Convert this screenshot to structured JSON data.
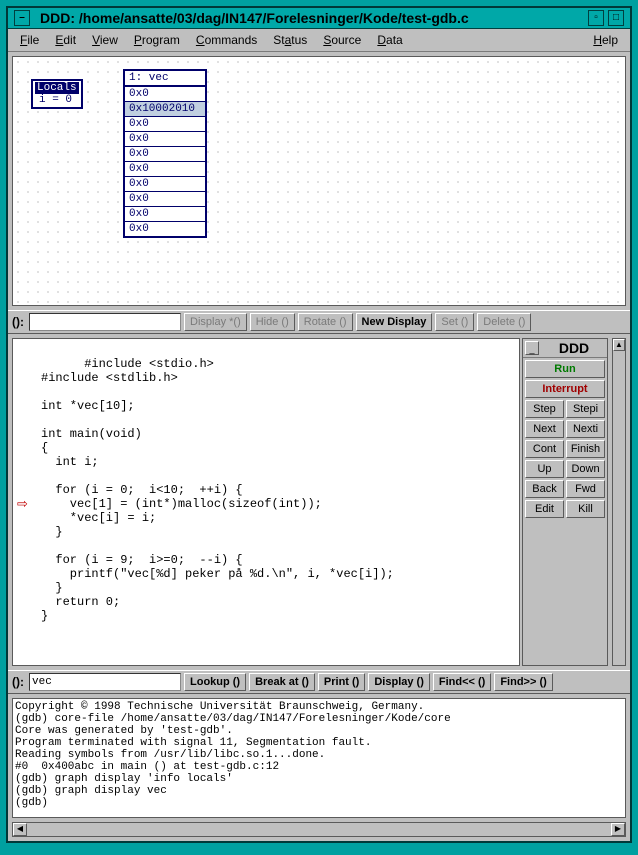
{
  "window": {
    "title": "DDD: /home/ansatte/03/dag/IN147/Forelesninger/Kode/test-gdb.c"
  },
  "menu": {
    "file": "File",
    "edit": "Edit",
    "view": "View",
    "program": "Program",
    "commands": "Commands",
    "status": "Status",
    "source": "Source",
    "data": "Data",
    "help": "Help"
  },
  "locals": {
    "title": "Locals",
    "row": "i = 0"
  },
  "vec": {
    "title": "1: vec",
    "rows": [
      "0x0",
      "0x10002010",
      "0x0",
      "0x0",
      "0x0",
      "0x0",
      "0x0",
      "0x0",
      "0x0",
      "0x0"
    ],
    "selected_index": 1
  },
  "argbar": {
    "label": "():",
    "value": "",
    "btns": {
      "display_star": "Display *()",
      "hide": "Hide ()",
      "rotate": "Rotate ()",
      "new_display": "New Display",
      "set": "Set ()",
      "delete": "Delete ()"
    }
  },
  "source_code": "#include <stdio.h>\n#include <stdlib.h>\n\nint *vec[10];\n\nint main(void)\n{\n  int i;\n\n  for (i = 0;  i<10;  ++i) {\n    vec[1] = (int*)malloc(sizeof(int));\n    *vec[i] = i;\n  }\n\n  for (i = 9;  i>=0;  --i) {\n    printf(\"vec[%d] peker på %d.\\n\", i, *vec[i]);\n  }\n  return 0;\n}",
  "stop_line_index": 11,
  "cmd_panel": {
    "title": "DDD",
    "run": "Run",
    "interrupt": "Interrupt",
    "step": "Step",
    "stepi": "Stepi",
    "next": "Next",
    "nexti": "Nexti",
    "cont": "Cont",
    "finish": "Finish",
    "up": "Up",
    "down": "Down",
    "back": "Back",
    "fwd": "Fwd",
    "edit": "Edit",
    "kill": "Kill"
  },
  "lookupbar": {
    "label": "():",
    "value": "vec",
    "btns": {
      "lookup": "Lookup ()",
      "break_at": "Break at ()",
      "print": "Print ()",
      "display": "Display ()",
      "find_prev": "Find<< ()",
      "find_next": "Find>> ()"
    }
  },
  "console_text": "Copyright © 1998 Technische Universität Braunschweig, Germany.\n(gdb) core-file /home/ansatte/03/dag/IN147/Forelesninger/Kode/core\nCore was generated by 'test-gdb'.\nProgram terminated with signal 11, Segmentation fault.\nReading symbols from /usr/lib/libc.so.1...done.\n#0  0x400abc in main () at test-gdb.c:12\n(gdb) graph display 'info locals'\n(gdb) graph display vec\n(gdb) "
}
